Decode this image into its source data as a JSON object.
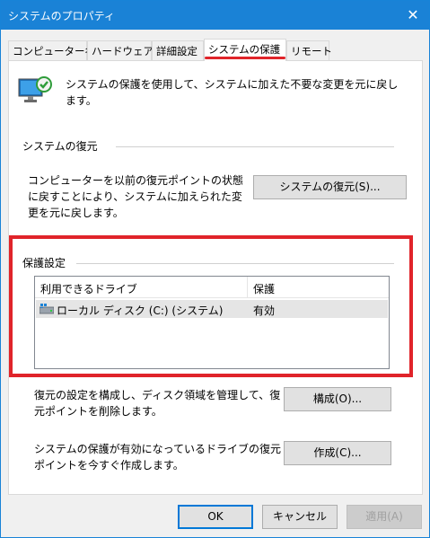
{
  "window": {
    "title": "システムのプロパティ",
    "close_glyph": "✕"
  },
  "tabs": [
    {
      "label": "コンピューター名"
    },
    {
      "label": "ハードウェア"
    },
    {
      "label": "詳細設定"
    },
    {
      "label": "システムの保護"
    },
    {
      "label": "リモート"
    }
  ],
  "intro": {
    "text": "システムの保護を使用して、システムに加えた不要な変更を元に戻します。"
  },
  "restore_group": {
    "label": "システムの復元",
    "description": "コンピューターを以前の復元ポイントの状態に戻すことにより、システムに加えられた変更を元に戻します。",
    "button_label": "システムの復元(S)..."
  },
  "protection_group": {
    "label": "保護設定",
    "columns": [
      "利用できるドライブ",
      "保護"
    ],
    "rows": [
      {
        "drive": "ローカル ディスク (C:) (システム)",
        "protection": "有効"
      }
    ]
  },
  "configure": {
    "description": "復元の設定を構成し、ディスク領域を管理して、復元ポイントを削除します。",
    "button_label": "構成(O)..."
  },
  "create": {
    "description": "システムの保護が有効になっているドライブの復元ポイントを今すぐ作成します。",
    "button_label": "作成(C)..."
  },
  "footer": {
    "ok_label": "OK",
    "cancel_label": "キャンセル",
    "apply_label": "適用(A)"
  },
  "colors": {
    "titlebar": "#1a82d6",
    "highlight": "#e0242a",
    "focus": "#0078d7"
  }
}
